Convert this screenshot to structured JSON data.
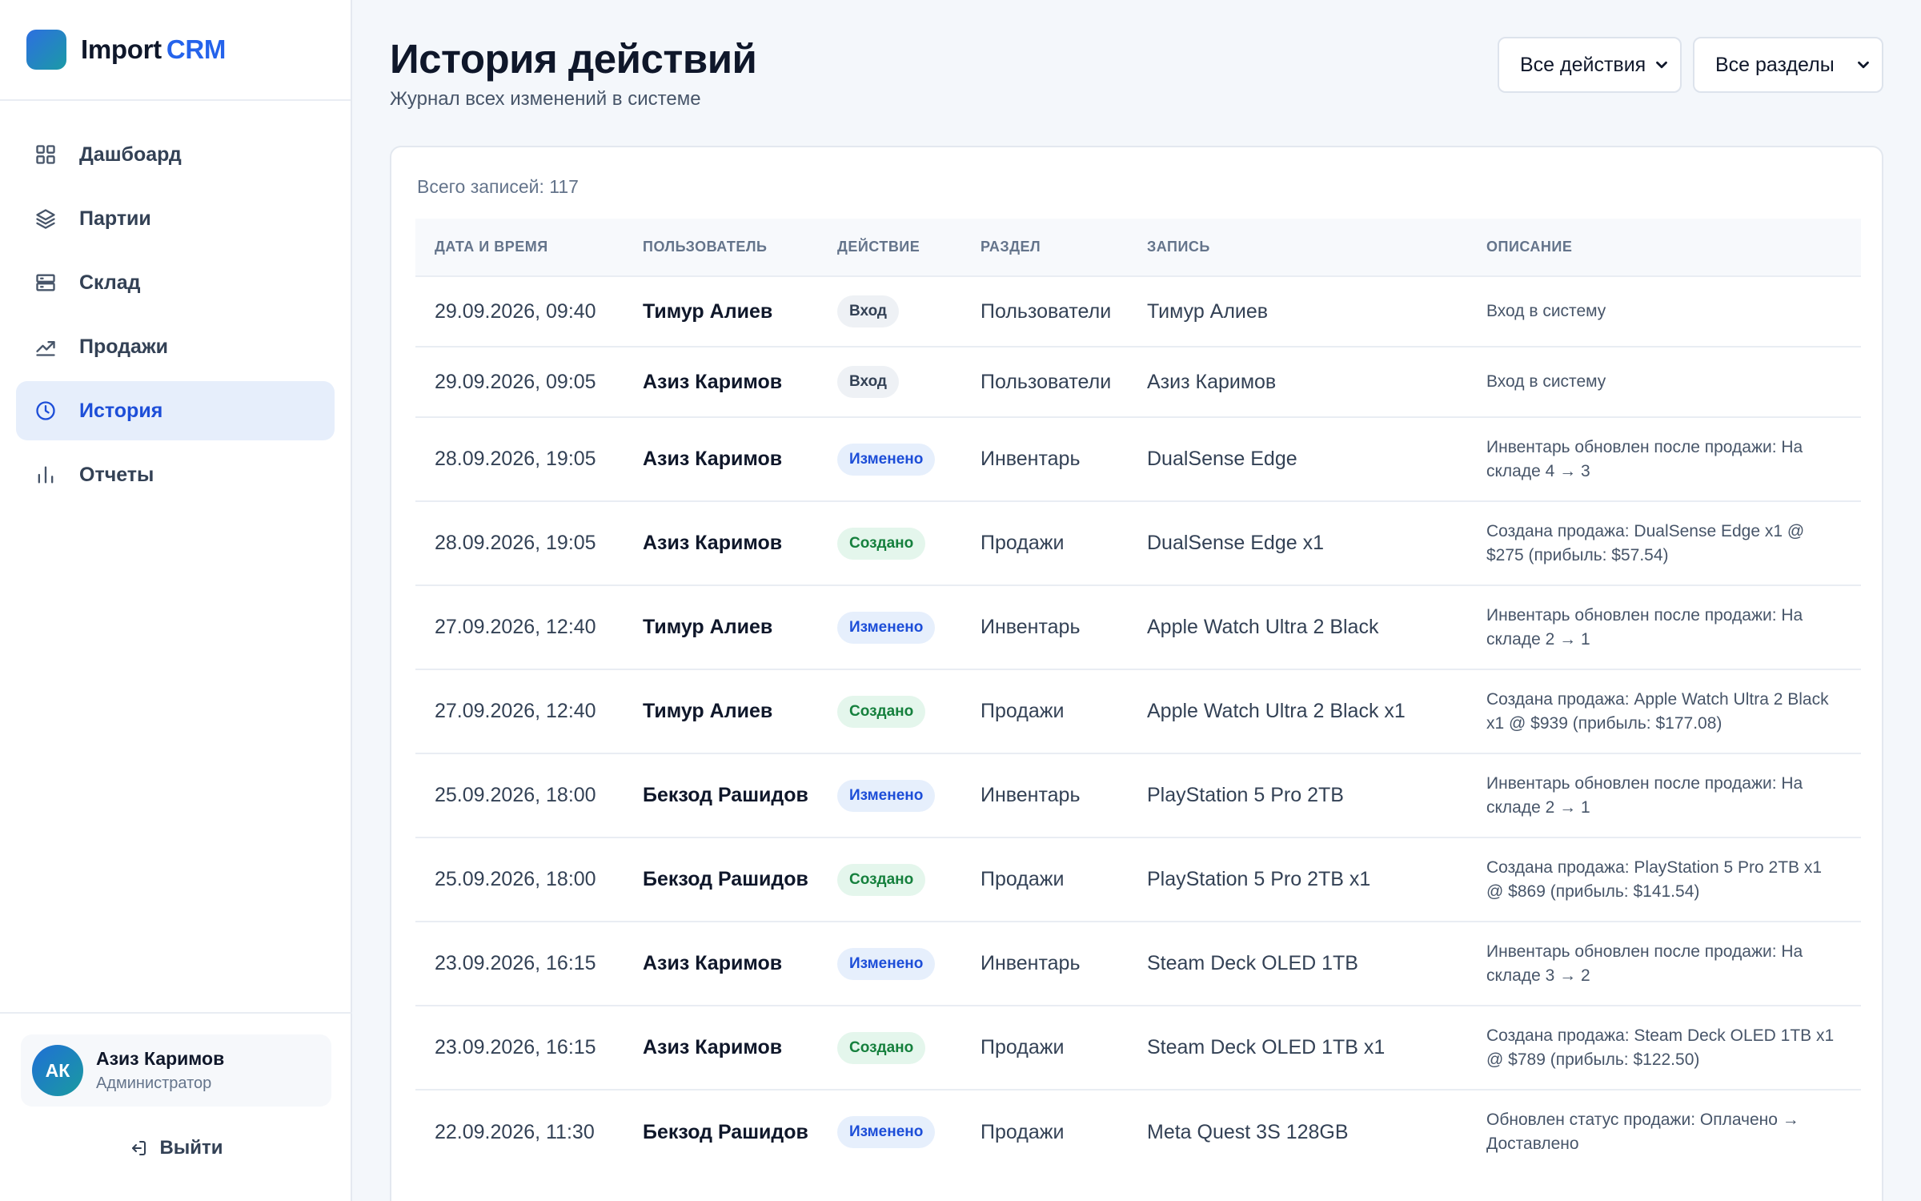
{
  "brand": {
    "name": "Import",
    "accent": "CRM"
  },
  "nav": [
    {
      "label": "Дашбоард",
      "icon": "dashboard-grid-icon",
      "active": false
    },
    {
      "label": "Партии",
      "icon": "layers-icon",
      "active": false
    },
    {
      "label": "Склад",
      "icon": "warehouse-icon",
      "active": false
    },
    {
      "label": "Продажи",
      "icon": "trending-chart-icon",
      "active": false
    },
    {
      "label": "История",
      "icon": "clock-icon",
      "active": true
    },
    {
      "label": "Отчеты",
      "icon": "bar-chart-icon",
      "active": false
    }
  ],
  "user": {
    "initials": "АК",
    "name": "Азиз Каримов",
    "role": "Администратор"
  },
  "logout_label": "Выйти",
  "page": {
    "title": "История действий",
    "subtitle": "Журнал всех изменений в системе"
  },
  "filters": {
    "actions": "Все действия",
    "sections": "Все разделы"
  },
  "total_label": "Всего записей: 117",
  "columns": [
    "Дата и время",
    "Пользователь",
    "Действие",
    "Раздел",
    "Запись",
    "Описание"
  ],
  "rows": [
    {
      "date": "29.09.2026, 09:40",
      "user": "Тимур Алиев",
      "action": "Вход",
      "action_type": "login",
      "section": "Пользователи",
      "record": "Тимур Алиев",
      "description": "Вход в систему"
    },
    {
      "date": "29.09.2026, 09:05",
      "user": "Азиз Каримов",
      "action": "Вход",
      "action_type": "login",
      "section": "Пользователи",
      "record": "Азиз Каримов",
      "description": "Вход в систему"
    },
    {
      "date": "28.09.2026, 19:05",
      "user": "Азиз Каримов",
      "action": "Изменено",
      "action_type": "changed",
      "section": "Инвентарь",
      "record": "DualSense Edge",
      "description": "Инвентарь обновлен после продажи: На складе 4 → 3"
    },
    {
      "date": "28.09.2026, 19:05",
      "user": "Азиз Каримов",
      "action": "Создано",
      "action_type": "created",
      "section": "Продажи",
      "record": "DualSense Edge x1",
      "description": "Создана продажа: DualSense Edge x1 @ $275 (прибыль: $57.54)"
    },
    {
      "date": "27.09.2026, 12:40",
      "user": "Тимур Алиев",
      "action": "Изменено",
      "action_type": "changed",
      "section": "Инвентарь",
      "record": "Apple Watch Ultra 2 Black",
      "description": "Инвентарь обновлен после продажи: На складе 2 → 1"
    },
    {
      "date": "27.09.2026, 12:40",
      "user": "Тимур Алиев",
      "action": "Создано",
      "action_type": "created",
      "section": "Продажи",
      "record": "Apple Watch Ultra 2 Black x1",
      "description": "Создана продажа: Apple Watch Ultra 2 Black x1 @ $939 (прибыль: $177.08)"
    },
    {
      "date": "25.09.2026, 18:00",
      "user": "Бекзод Рашидов",
      "action": "Изменено",
      "action_type": "changed",
      "section": "Инвентарь",
      "record": "PlayStation 5 Pro 2TB",
      "description": "Инвентарь обновлен после продажи: На складе 2 → 1"
    },
    {
      "date": "25.09.2026, 18:00",
      "user": "Бекзод Рашидов",
      "action": "Создано",
      "action_type": "created",
      "section": "Продажи",
      "record": "PlayStation 5 Pro 2TB x1",
      "description": "Создана продажа: PlayStation 5 Pro 2TB x1 @ $869 (прибыль: $141.54)"
    },
    {
      "date": "23.09.2026, 16:15",
      "user": "Азиз Каримов",
      "action": "Изменено",
      "action_type": "changed",
      "section": "Инвентарь",
      "record": "Steam Deck OLED 1TB",
      "description": "Инвентарь обновлен после продажи: На складе 3 → 2"
    },
    {
      "date": "23.09.2026, 16:15",
      "user": "Азиз Каримов",
      "action": "Создано",
      "action_type": "created",
      "section": "Продажи",
      "record": "Steam Deck OLED 1TB x1",
      "description": "Создана продажа: Steam Deck OLED 1TB x1 @ $789 (прибыль: $122.50)"
    },
    {
      "date": "22.09.2026, 11:30",
      "user": "Бекзод Рашидов",
      "action": "Изменено",
      "action_type": "changed",
      "section": "Продажи",
      "record": "Meta Quest 3S 128GB",
      "description": "Обновлен статус продажи: Оплачено → Доставлено"
    }
  ]
}
